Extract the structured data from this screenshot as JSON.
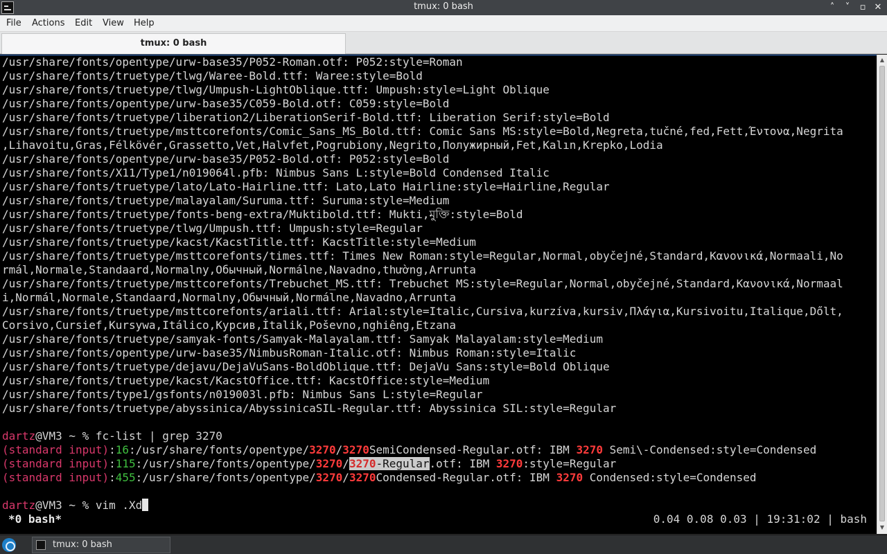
{
  "window": {
    "title": "tmux: 0 bash",
    "controls": [
      "˄",
      "˅",
      "▫",
      "✕"
    ]
  },
  "menu": [
    "File",
    "Actions",
    "Edit",
    "View",
    "Help"
  ],
  "tab": {
    "label": "tmux: 0 bash"
  },
  "terminal": {
    "output": [
      "/usr/share/fonts/opentype/urw-base35/P052-Roman.otf: P052:style=Roman",
      "/usr/share/fonts/truetype/tlwg/Waree-Bold.ttf: Waree:style=Bold",
      "/usr/share/fonts/truetype/tlwg/Umpush-LightOblique.ttf: Umpush:style=Light Oblique",
      "/usr/share/fonts/opentype/urw-base35/C059-Bold.otf: C059:style=Bold",
      "/usr/share/fonts/truetype/liberation2/LiberationSerif-Bold.ttf: Liberation Serif:style=Bold",
      "/usr/share/fonts/truetype/msttcorefonts/Comic_Sans_MS_Bold.ttf: Comic Sans MS:style=Bold,Negreta,tučné,fed,Fett,Έντονα,Negrita",
      ",Lihavoitu,Gras,Félkövér,Grassetto,Vet,Halvfet,Pogrubiony,Negrito,Полужирный,Fet,Kalın,Krepko,Lodia",
      "/usr/share/fonts/opentype/urw-base35/P052-Bold.otf: P052:style=Bold",
      "/usr/share/fonts/X11/Type1/n019064l.pfb: Nimbus Sans L:style=Bold Condensed Italic",
      "/usr/share/fonts/truetype/lato/Lato-Hairline.ttf: Lato,Lato Hairline:style=Hairline,Regular",
      "/usr/share/fonts/truetype/malayalam/Suruma.ttf: Suruma:style=Medium",
      "/usr/share/fonts/truetype/fonts-beng-extra/Muktibold.ttf: Mukti,মুক্তি:style=Bold",
      "/usr/share/fonts/truetype/tlwg/Umpush.ttf: Umpush:style=Regular",
      "/usr/share/fonts/truetype/kacst/KacstTitle.ttf: KacstTitle:style=Medium",
      "/usr/share/fonts/truetype/msttcorefonts/times.ttf: Times New Roman:style=Regular,Normal,obyčejné,Standard,Κανονικά,Normaali,No",
      "rmál,Normale,Standaard,Normalny,Обычный,Normálne,Navadno,thường,Arrunta",
      "/usr/share/fonts/truetype/msttcorefonts/Trebuchet_MS.ttf: Trebuchet MS:style=Regular,Normal,obyčejné,Standard,Κανονικά,Normaal",
      "i,Normál,Normale,Standaard,Normalny,Обычный,Normálne,Navadno,Arrunta",
      "/usr/share/fonts/truetype/msttcorefonts/ariali.ttf: Arial:style=Italic,Cursiva,kurzíva,kursiv,Πλάγια,Kursivoitu,Italique,Dőlt,",
      "Corsivo,Cursief,Kursywa,Itálico,Курсив,İtalik,Poševno,nghiêng,Etzana",
      "/usr/share/fonts/truetype/samyak-fonts/Samyak-Malayalam.ttf: Samyak Malayalam:style=Medium",
      "/usr/share/fonts/opentype/urw-base35/NimbusRoman-Italic.otf: Nimbus Roman:style=Italic",
      "/usr/share/fonts/truetype/dejavu/DejaVuSans-BoldOblique.ttf: DejaVu Sans:style=Bold Oblique",
      "/usr/share/fonts/truetype/kacst/KacstOffice.ttf: KacstOffice:style=Medium",
      "/usr/share/fonts/type1/gsfonts/n019003l.pfb: Nimbus Sans L:style=Regular",
      "/usr/share/fonts/truetype/abyssinica/AbyssinicaSIL-Regular.ttf: Abyssinica SIL:style=Regular",
      ""
    ],
    "prompt_user": "dartz",
    "prompt_host": "@VM3 ~ % ",
    "command1": "fc-list | grep 3270",
    "grep_label": "(standard input)",
    "grep_results": [
      {
        "lineno": "16",
        "pre": "/usr/share/fonts/opentype/",
        "m1": "3270",
        "sep": "/",
        "m2": "3270",
        "mid": "SemiCondensed-Regular.otf: IBM ",
        "m3": "3270",
        "post": " Semi\\-Condensed:style=Condensed",
        "selected": false
      },
      {
        "lineno": "115",
        "pre": "/usr/share/fonts/opentype/",
        "m1": "3270",
        "sep": "/",
        "m2": "3270",
        "mid": "-Regular",
        "mid2": ".otf: IBM ",
        "m3": "3270",
        "post": ":style=Regular",
        "selected": true
      },
      {
        "lineno": "455",
        "pre": "/usr/share/fonts/opentype/",
        "m1": "3270",
        "sep": "/",
        "m2": "3270",
        "mid": "Condensed-Regular.otf: IBM ",
        "m3": "3270",
        "post": " Condensed:style=Condensed",
        "selected": false
      }
    ],
    "command2": "vim .Xd"
  },
  "status": {
    "left": "*0 bash*",
    "right": "0.04 0.08 0.03 | 19:31:02 | bash"
  },
  "taskbar": {
    "task_label": "tmux: 0 bash"
  }
}
